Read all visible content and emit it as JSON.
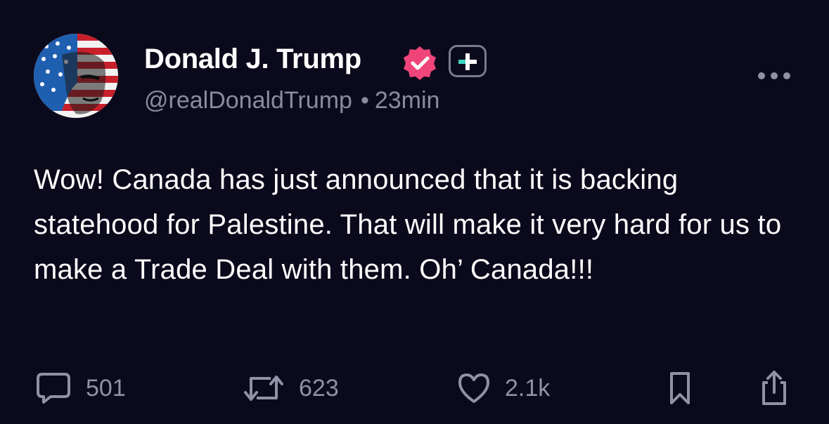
{
  "author": {
    "display_name": "Donald J. Trump",
    "handle": "@realDonaldTrump",
    "separator": "•",
    "time_ago": "23min",
    "verified_color": "#f0457a",
    "avatar_icon": "flag-portrait-avatar"
  },
  "post": {
    "text": "Wow! Canada has just announced that it is backing statehood for Palestine. That will make it very hard for us to make a Trade Deal with them. Oh’ Canada!!!"
  },
  "actions": {
    "replies": "501",
    "reposts": "623",
    "likes": "2.1k"
  },
  "icons": [
    "verified-icon",
    "plus-badge-icon",
    "more-icon",
    "reply-icon",
    "repost-icon",
    "heart-icon",
    "bookmark-icon",
    "share-icon"
  ],
  "colors": {
    "background": "#0b0a1c",
    "text": "#ffffff",
    "muted": "#8b8aa0",
    "verified": "#f0457a",
    "plus_accent": "#3fd4c3"
  }
}
